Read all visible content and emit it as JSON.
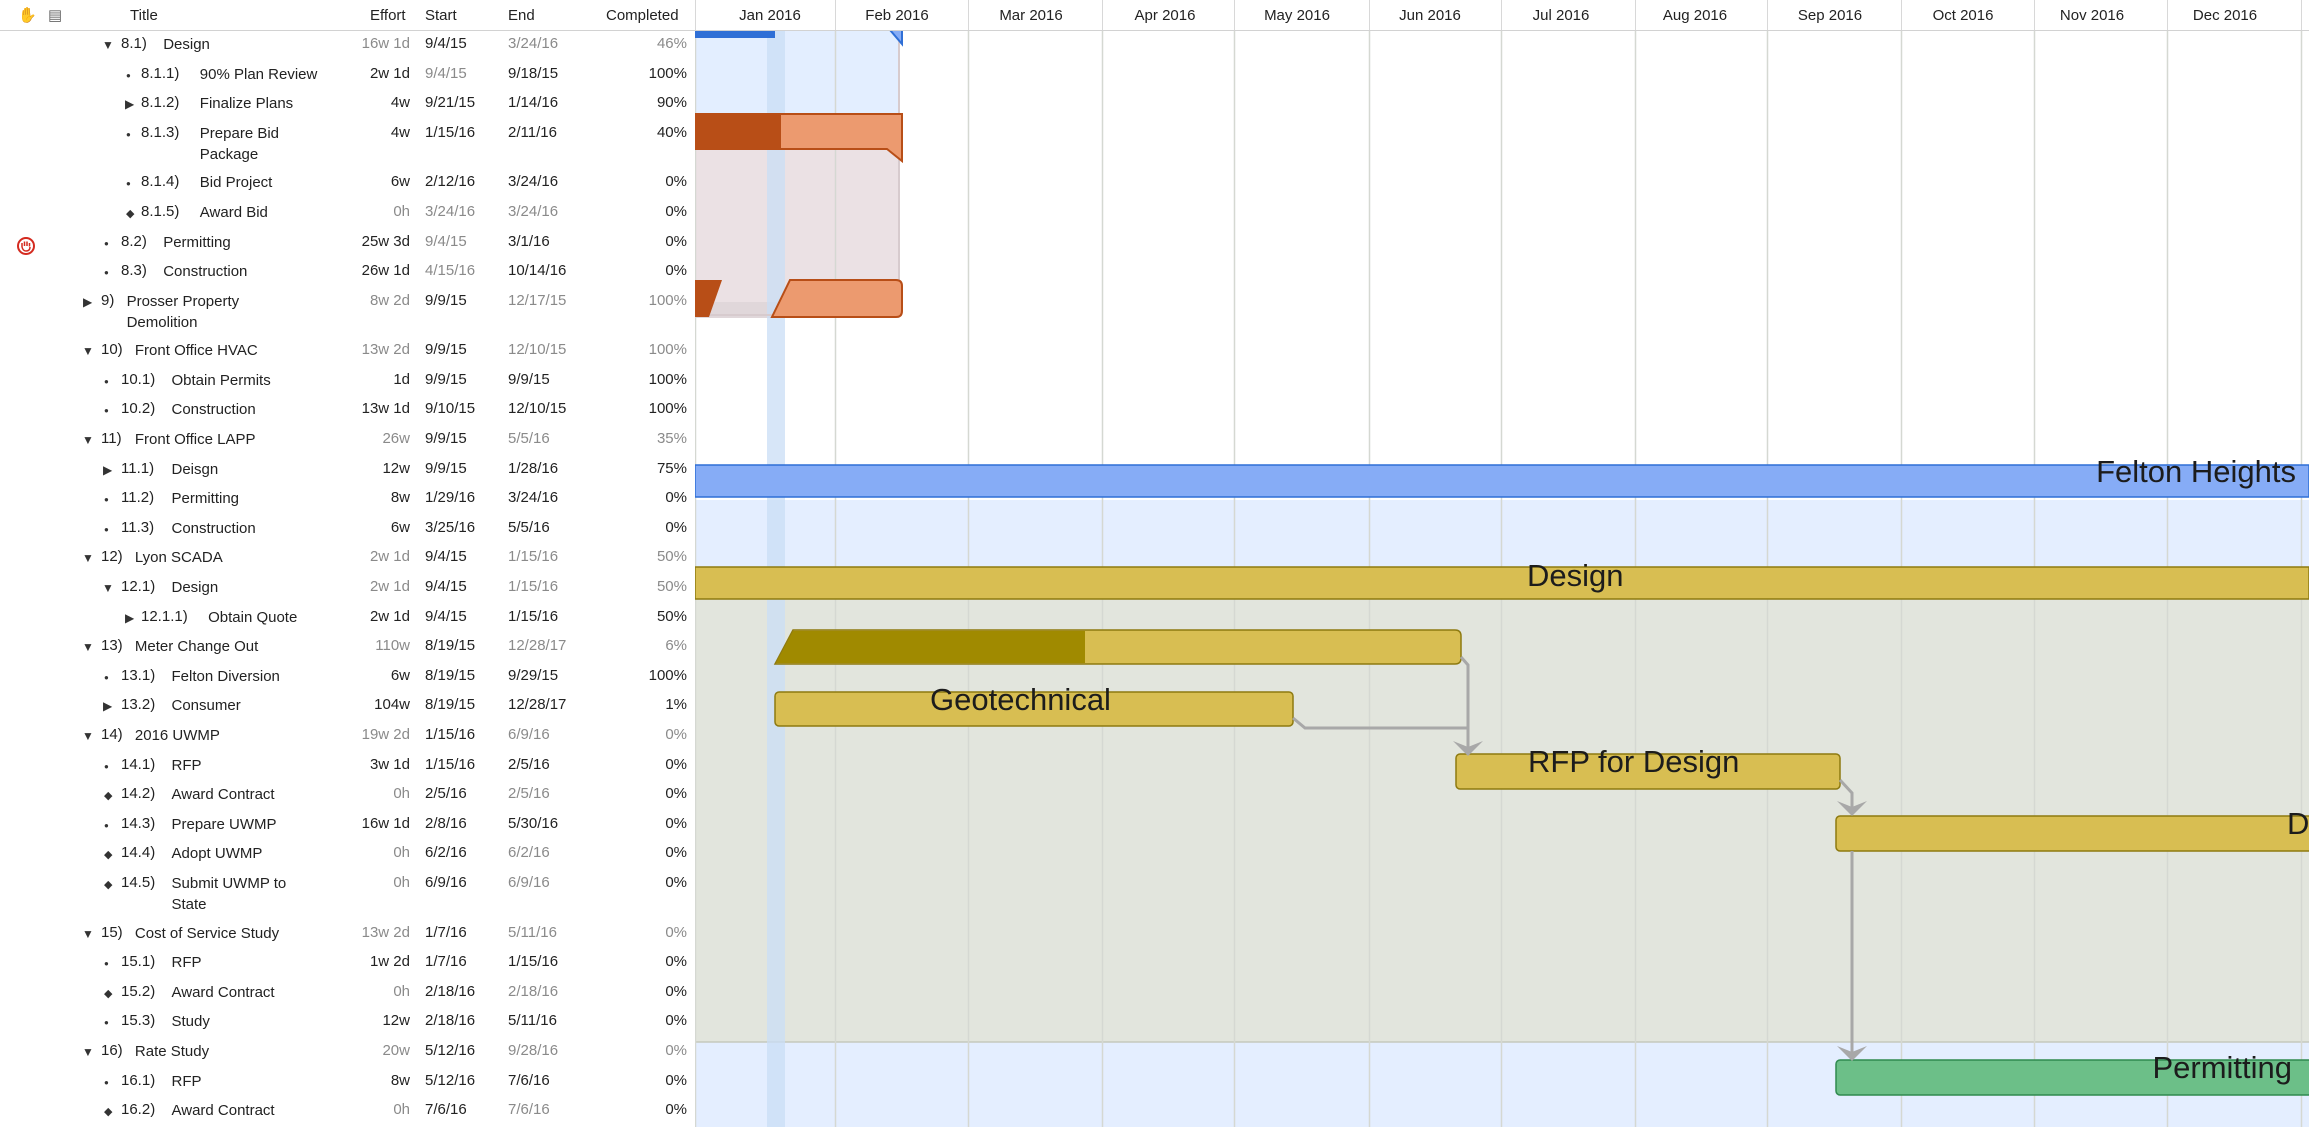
{
  "header": {
    "col_title": "Title",
    "col_effort": "Effort",
    "col_start": "Start",
    "col_end": "End",
    "col_completed": "Completed",
    "months": [
      "Jan 2016",
      "Feb 2016",
      "Mar 2016",
      "Apr 2016",
      "May 2016",
      "Jun 2016",
      "Jul 2016",
      "Aug 2016",
      "Sep 2016",
      "Oct 2016",
      "Nov 2016",
      "Dec 2016"
    ]
  },
  "rows": [
    {
      "num": "8.1)",
      "title": "Design",
      "title2": "",
      "effort": "16w 1d",
      "start": "9/4/15",
      "end": "3/24/16",
      "completed": "46%",
      "level": 1,
      "marker": "open",
      "g_effort": true,
      "g_start": false,
      "g_end": true,
      "g_comp": true
    },
    {
      "num": "8.1.1)",
      "title": "90% Plan Review",
      "title2": "",
      "effort": "2w 1d",
      "start": "9/4/15",
      "end": "9/18/15",
      "completed": "100%",
      "level": 2,
      "marker": "dot",
      "g_effort": false,
      "g_start": true,
      "g_end": false,
      "g_comp": false
    },
    {
      "num": "8.1.2)",
      "title": "Finalize Plans",
      "title2": "",
      "effort": "4w",
      "start": "9/21/15",
      "end": "1/14/16",
      "completed": "90%",
      "level": 2,
      "marker": "closed",
      "g_effort": false,
      "g_start": false,
      "g_end": false,
      "g_comp": false
    },
    {
      "num": "8.1.3)",
      "title": "Prepare Bid",
      "title2": "Package",
      "effort": "4w",
      "start": "1/15/16",
      "end": "2/11/16",
      "completed": "40%",
      "level": 2,
      "marker": "dot",
      "g_effort": false,
      "g_start": false,
      "g_end": false,
      "g_comp": false
    },
    {
      "num": "8.1.4)",
      "title": "Bid Project",
      "title2": "",
      "effort": "6w",
      "start": "2/12/16",
      "end": "3/24/16",
      "completed": "0%",
      "level": 2,
      "marker": "dot",
      "g_effort": false,
      "g_start": false,
      "g_end": false,
      "g_comp": false
    },
    {
      "num": "8.1.5)",
      "title": "Award Bid",
      "title2": "",
      "effort": "0h",
      "start": "3/24/16",
      "end": "3/24/16",
      "completed": "0%",
      "level": 2,
      "marker": "diamond",
      "g_effort": true,
      "g_start": true,
      "g_end": true,
      "g_comp": false
    },
    {
      "num": "8.2)",
      "title": "Permitting",
      "title2": "",
      "effort": "25w 3d",
      "start": "9/4/15",
      "end": "3/1/16",
      "completed": "0%",
      "level": 1,
      "marker": "dot",
      "g_effort": false,
      "g_start": true,
      "g_end": false,
      "g_comp": false
    },
    {
      "num": "8.3)",
      "title": "Construction",
      "title2": "",
      "effort": "26w 1d",
      "start": "4/15/16",
      "end": "10/14/16",
      "completed": "0%",
      "level": 1,
      "marker": "dot",
      "g_effort": false,
      "g_start": true,
      "g_end": false,
      "g_comp": false
    },
    {
      "num": "9)",
      "title": "Prosser Property",
      "title2": "Demolition",
      "effort": "8w 2d",
      "start": "9/9/15",
      "end": "12/17/15",
      "completed": "100%",
      "level": 0,
      "marker": "closed",
      "g_effort": true,
      "g_start": false,
      "g_end": true,
      "g_comp": true
    },
    {
      "num": "10)",
      "title": "Front Office HVAC",
      "title2": "",
      "effort": "13w 2d",
      "start": "9/9/15",
      "end": "12/10/15",
      "completed": "100%",
      "level": 0,
      "marker": "open",
      "g_effort": true,
      "g_start": false,
      "g_end": true,
      "g_comp": true
    },
    {
      "num": "10.1)",
      "title": "Obtain Permits",
      "title2": "",
      "effort": "1d",
      "start": "9/9/15",
      "end": "9/9/15",
      "completed": "100%",
      "level": 1,
      "marker": "dot",
      "g_effort": false,
      "g_start": false,
      "g_end": false,
      "g_comp": false
    },
    {
      "num": "10.2)",
      "title": "Construction",
      "title2": "",
      "effort": "13w 1d",
      "start": "9/10/15",
      "end": "12/10/15",
      "completed": "100%",
      "level": 1,
      "marker": "dot",
      "g_effort": false,
      "g_start": false,
      "g_end": false,
      "g_comp": false
    },
    {
      "num": "11)",
      "title": "Front Office LAPP",
      "title2": "",
      "effort": "26w",
      "start": "9/9/15",
      "end": "5/5/16",
      "completed": "35%",
      "level": 0,
      "marker": "open",
      "g_effort": true,
      "g_start": false,
      "g_end": true,
      "g_comp": true
    },
    {
      "num": "11.1)",
      "title": "Deisgn",
      "title2": "",
      "effort": "12w",
      "start": "9/9/15",
      "end": "1/28/16",
      "completed": "75%",
      "level": 1,
      "marker": "closed",
      "g_effort": false,
      "g_start": false,
      "g_end": false,
      "g_comp": false
    },
    {
      "num": "11.2)",
      "title": "Permitting",
      "title2": "",
      "effort": "8w",
      "start": "1/29/16",
      "end": "3/24/16",
      "completed": "0%",
      "level": 1,
      "marker": "dot",
      "g_effort": false,
      "g_start": false,
      "g_end": false,
      "g_comp": false
    },
    {
      "num": "11.3)",
      "title": "Construction",
      "title2": "",
      "effort": "6w",
      "start": "3/25/16",
      "end": "5/5/16",
      "completed": "0%",
      "level": 1,
      "marker": "dot",
      "g_effort": false,
      "g_start": false,
      "g_end": false,
      "g_comp": false
    },
    {
      "num": "12)",
      "title": "Lyon SCADA",
      "title2": "",
      "effort": "2w 1d",
      "start": "9/4/15",
      "end": "1/15/16",
      "completed": "50%",
      "level": 0,
      "marker": "open",
      "g_effort": true,
      "g_start": false,
      "g_end": true,
      "g_comp": true
    },
    {
      "num": "12.1)",
      "title": "Design",
      "title2": "",
      "effort": "2w 1d",
      "start": "9/4/15",
      "end": "1/15/16",
      "completed": "50%",
      "level": 1,
      "marker": "open",
      "g_effort": true,
      "g_start": false,
      "g_end": true,
      "g_comp": true
    },
    {
      "num": "12.1.1)",
      "title": "Obtain Quote",
      "title2": "",
      "effort": "2w 1d",
      "start": "9/4/15",
      "end": "1/15/16",
      "completed": "50%",
      "level": 2,
      "marker": "closed",
      "g_effort": false,
      "g_start": false,
      "g_end": false,
      "g_comp": false
    },
    {
      "num": "13)",
      "title": "Meter Change Out",
      "title2": "",
      "effort": "110w",
      "start": "8/19/15",
      "end": "12/28/17",
      "completed": "6%",
      "level": 0,
      "marker": "open",
      "g_effort": true,
      "g_start": false,
      "g_end": true,
      "g_comp": true
    },
    {
      "num": "13.1)",
      "title": "Felton Diversion",
      "title2": "",
      "effort": "6w",
      "start": "8/19/15",
      "end": "9/29/15",
      "completed": "100%",
      "level": 1,
      "marker": "dot",
      "g_effort": false,
      "g_start": false,
      "g_end": false,
      "g_comp": false
    },
    {
      "num": "13.2)",
      "title": "Consumer",
      "title2": "",
      "effort": "104w",
      "start": "8/19/15",
      "end": "12/28/17",
      "completed": "1%",
      "level": 1,
      "marker": "closed",
      "g_effort": false,
      "g_start": false,
      "g_end": false,
      "g_comp": false
    },
    {
      "num": "14)",
      "title": "2016 UWMP",
      "title2": "",
      "effort": "19w 2d",
      "start": "1/15/16",
      "end": "6/9/16",
      "completed": "0%",
      "level": 0,
      "marker": "open",
      "g_effort": true,
      "g_start": false,
      "g_end": true,
      "g_comp": true
    },
    {
      "num": "14.1)",
      "title": "RFP",
      "title2": "",
      "effort": "3w 1d",
      "start": "1/15/16",
      "end": "2/5/16",
      "completed": "0%",
      "level": 1,
      "marker": "dot",
      "g_effort": false,
      "g_start": false,
      "g_end": false,
      "g_comp": false
    },
    {
      "num": "14.2)",
      "title": "Award Contract",
      "title2": "",
      "effort": "0h",
      "start": "2/5/16",
      "end": "2/5/16",
      "completed": "0%",
      "level": 1,
      "marker": "diamond",
      "g_effort": true,
      "g_start": false,
      "g_end": true,
      "g_comp": false
    },
    {
      "num": "14.3)",
      "title": "Prepare UWMP",
      "title2": "",
      "effort": "16w 1d",
      "start": "2/8/16",
      "end": "5/30/16",
      "completed": "0%",
      "level": 1,
      "marker": "dot",
      "g_effort": false,
      "g_start": false,
      "g_end": false,
      "g_comp": false
    },
    {
      "num": "14.4)",
      "title": "Adopt UWMP",
      "title2": "",
      "effort": "0h",
      "start": "6/2/16",
      "end": "6/2/16",
      "completed": "0%",
      "level": 1,
      "marker": "diamond",
      "g_effort": true,
      "g_start": false,
      "g_end": true,
      "g_comp": false
    },
    {
      "num": "14.5)",
      "title": "Submit UWMP to",
      "title2": "State",
      "effort": "0h",
      "start": "6/9/16",
      "end": "6/9/16",
      "completed": "0%",
      "level": 1,
      "marker": "diamond",
      "g_effort": true,
      "g_start": false,
      "g_end": true,
      "g_comp": false
    },
    {
      "num": "15)",
      "title": "Cost of Service Study",
      "title2": "",
      "effort": "13w 2d",
      "start": "1/7/16",
      "end": "5/11/16",
      "completed": "0%",
      "level": 0,
      "marker": "open",
      "g_effort": true,
      "g_start": false,
      "g_end": true,
      "g_comp": true
    },
    {
      "num": "15.1)",
      "title": "RFP",
      "title2": "",
      "effort": "1w 2d",
      "start": "1/7/16",
      "end": "1/15/16",
      "completed": "0%",
      "level": 1,
      "marker": "dot",
      "g_effort": false,
      "g_start": false,
      "g_end": false,
      "g_comp": false
    },
    {
      "num": "15.2)",
      "title": "Award Contract",
      "title2": "",
      "effort": "0h",
      "start": "2/18/16",
      "end": "2/18/16",
      "completed": "0%",
      "level": 1,
      "marker": "diamond",
      "g_effort": true,
      "g_start": false,
      "g_end": true,
      "g_comp": false
    },
    {
      "num": "15.3)",
      "title": "Study",
      "title2": "",
      "effort": "12w",
      "start": "2/18/16",
      "end": "5/11/16",
      "completed": "0%",
      "level": 1,
      "marker": "dot",
      "g_effort": false,
      "g_start": false,
      "g_end": false,
      "g_comp": false
    },
    {
      "num": "16)",
      "title": "Rate Study",
      "title2": "",
      "effort": "20w",
      "start": "5/12/16",
      "end": "9/28/16",
      "completed": "0%",
      "level": 0,
      "marker": "open",
      "g_effort": true,
      "g_start": false,
      "g_end": true,
      "g_comp": true
    },
    {
      "num": "16.1)",
      "title": "RFP",
      "title2": "",
      "effort": "8w",
      "start": "5/12/16",
      "end": "7/6/16",
      "completed": "0%",
      "level": 1,
      "marker": "dot",
      "g_effort": false,
      "g_start": false,
      "g_end": false,
      "g_comp": false
    },
    {
      "num": "16.2)",
      "title": "Award Contract",
      "title2": "",
      "effort": "0h",
      "start": "7/6/16",
      "end": "7/6/16",
      "completed": "0%",
      "level": 1,
      "marker": "diamond",
      "g_effort": true,
      "g_start": false,
      "g_end": true,
      "g_comp": false
    }
  ],
  "gantt_labels": {
    "felton": "Felton Heights",
    "design": "Design",
    "geotechnical": "Geotechnical",
    "rfp_design": "RFP for Design",
    "cutoff_d": "D",
    "permitting": "Permitting"
  },
  "colors": {
    "blue_bar": "#86acf6",
    "blue_dark": "#2f6fd6",
    "orange_dark": "#b84e17",
    "orange_light": "#ec9a6f",
    "olive_dark": "#a08a00",
    "olive_light": "#d8be52",
    "green_bar": "#6cbf88",
    "today": "#c9ddf5"
  }
}
